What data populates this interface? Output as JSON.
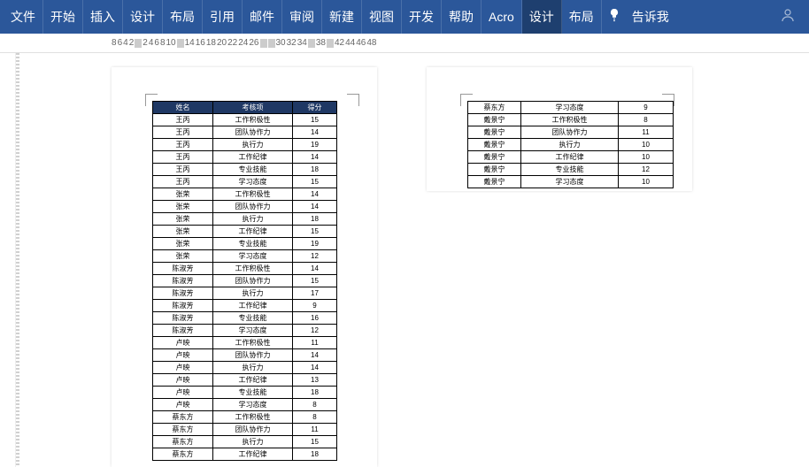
{
  "ribbon": {
    "tabs": [
      "文件",
      "开始",
      "插入",
      "设计",
      "布局",
      "引用",
      "邮件",
      "审阅",
      "新建",
      "视图",
      "开发",
      "帮助",
      "Acro",
      "设计",
      "布局"
    ],
    "activeIndex": 13,
    "tellme": "告诉我"
  },
  "ruler": [
    "8",
    "6",
    "4",
    "2",
    "",
    "2",
    "4",
    "6",
    "8",
    "10",
    "",
    "14",
    "16",
    "18",
    "20",
    "22",
    "24",
    "26",
    "",
    "",
    "30",
    "32",
    "34",
    "",
    "38",
    "",
    "42",
    "44",
    "46",
    "48"
  ],
  "table1": {
    "headers": [
      "姓名",
      "考核项",
      "得分"
    ],
    "rows": [
      [
        "王丙",
        "工作积极性",
        "15"
      ],
      [
        "王丙",
        "团队协作力",
        "14"
      ],
      [
        "王丙",
        "执行力",
        "19"
      ],
      [
        "王丙",
        "工作纪律",
        "14"
      ],
      [
        "王丙",
        "专业技能",
        "18"
      ],
      [
        "王丙",
        "学习态度",
        "15"
      ],
      [
        "张荣",
        "工作积极性",
        "14"
      ],
      [
        "张荣",
        "团队协作力",
        "14"
      ],
      [
        "张荣",
        "执行力",
        "18"
      ],
      [
        "张荣",
        "工作纪律",
        "15"
      ],
      [
        "张荣",
        "专业技能",
        "19"
      ],
      [
        "张荣",
        "学习态度",
        "12"
      ],
      [
        "陈淑芳",
        "工作积极性",
        "14"
      ],
      [
        "陈淑芳",
        "团队协作力",
        "15"
      ],
      [
        "陈淑芳",
        "执行力",
        "17"
      ],
      [
        "陈淑芳",
        "工作纪律",
        "9"
      ],
      [
        "陈淑芳",
        "专业技能",
        "16"
      ],
      [
        "陈淑芳",
        "学习态度",
        "12"
      ],
      [
        "卢映",
        "工作积极性",
        "11"
      ],
      [
        "卢映",
        "团队协作力",
        "14"
      ],
      [
        "卢映",
        "执行力",
        "14"
      ],
      [
        "卢映",
        "工作纪律",
        "13"
      ],
      [
        "卢映",
        "专业技能",
        "18"
      ],
      [
        "卢映",
        "学习态度",
        "8"
      ],
      [
        "蔡东方",
        "工作积极性",
        "8"
      ],
      [
        "蔡东方",
        "团队协作力",
        "11"
      ],
      [
        "蔡东方",
        "执行力",
        "15"
      ],
      [
        "蔡东方",
        "工作纪律",
        "18"
      ]
    ]
  },
  "table2": {
    "rows": [
      [
        "蔡东方",
        "学习态度",
        "9"
      ],
      [
        "戴景宁",
        "工作积极性",
        "8"
      ],
      [
        "戴景宁",
        "团队协作力",
        "11"
      ],
      [
        "戴景宁",
        "执行力",
        "10"
      ],
      [
        "戴景宁",
        "工作纪律",
        "10"
      ],
      [
        "戴景宁",
        "专业技能",
        "12"
      ],
      [
        "戴景宁",
        "学习态度",
        "10"
      ]
    ]
  }
}
